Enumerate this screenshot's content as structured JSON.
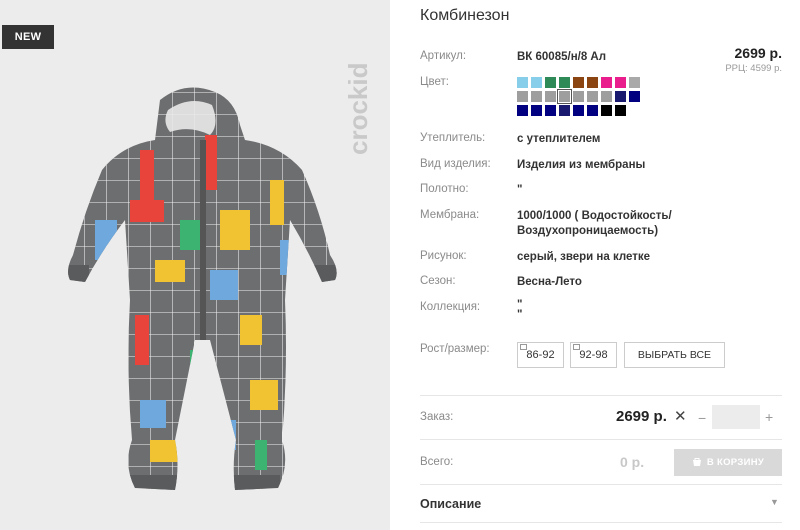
{
  "badge": "NEW",
  "brand": "crockid",
  "product": {
    "title": "Комбинезон",
    "price": "2699 р.",
    "rrp": "РРЦ: 4599 р."
  },
  "attributes": {
    "article_label": "Артикул:",
    "article_value": "ВК 60085/н/8 Ал",
    "color_label": "Цвет:",
    "insulation_label": "Утеплитель:",
    "insulation_value": "с утеплителем",
    "type_label": "Вид изделия:",
    "type_value": "Изделия из мембраны",
    "fabric_label": "Полотно:",
    "fabric_value": "\"",
    "membrane_label": "Мембрана:",
    "membrane_value_1": "1000/1000 ( Водостойкость/",
    "membrane_value_2": "Воздухопроницаемость)",
    "pattern_label": "Рисунок:",
    "pattern_value": "серый, звери на клетке",
    "season_label": "Сезон:",
    "season_value": "Весна-Лето",
    "collection_label": "Коллекция:",
    "collection_value_1": "\"",
    "collection_value_2": "\"",
    "size_label": "Рост/размер:"
  },
  "swatch_colors": [
    [
      "#87ceeb",
      "#87ceeb",
      "#2e8b57",
      "#2e8b57",
      "#8b4513",
      "#8b4513",
      "#e91e8c",
      "#e91e8c",
      "#a9a9a9"
    ],
    [
      "#9e9e9e",
      "#9e9e9e",
      "#9e9e9e",
      "#9e9e9e",
      "#9e9e9e",
      "#9e9e9e",
      "#9e9e9e",
      "#191970",
      "#000080"
    ],
    [
      "#000080",
      "#000080",
      "#000080",
      "#191970",
      "#000080",
      "#000080",
      "#000000",
      "#000000"
    ]
  ],
  "sizes": [
    "86-92",
    "92-98"
  ],
  "select_all": "ВЫБРАТЬ ВСЕ",
  "order": {
    "label": "Заказ:",
    "price": "2699 р.",
    "x": "✕",
    "minus": "−",
    "plus": "+",
    "qty": ""
  },
  "total": {
    "label": "Всего:",
    "value": "0 р.",
    "cart_button": "В КОРЗИНУ"
  },
  "description": {
    "title": "Описание",
    "toggle": "▼"
  },
  "colors": {
    "accent_dark": "#333333",
    "garment_base": "#6d6e70",
    "grid_line": "#f2f2f2"
  },
  "icons": [
    "cart-icon",
    "chevron-down-icon",
    "close-icon"
  ]
}
